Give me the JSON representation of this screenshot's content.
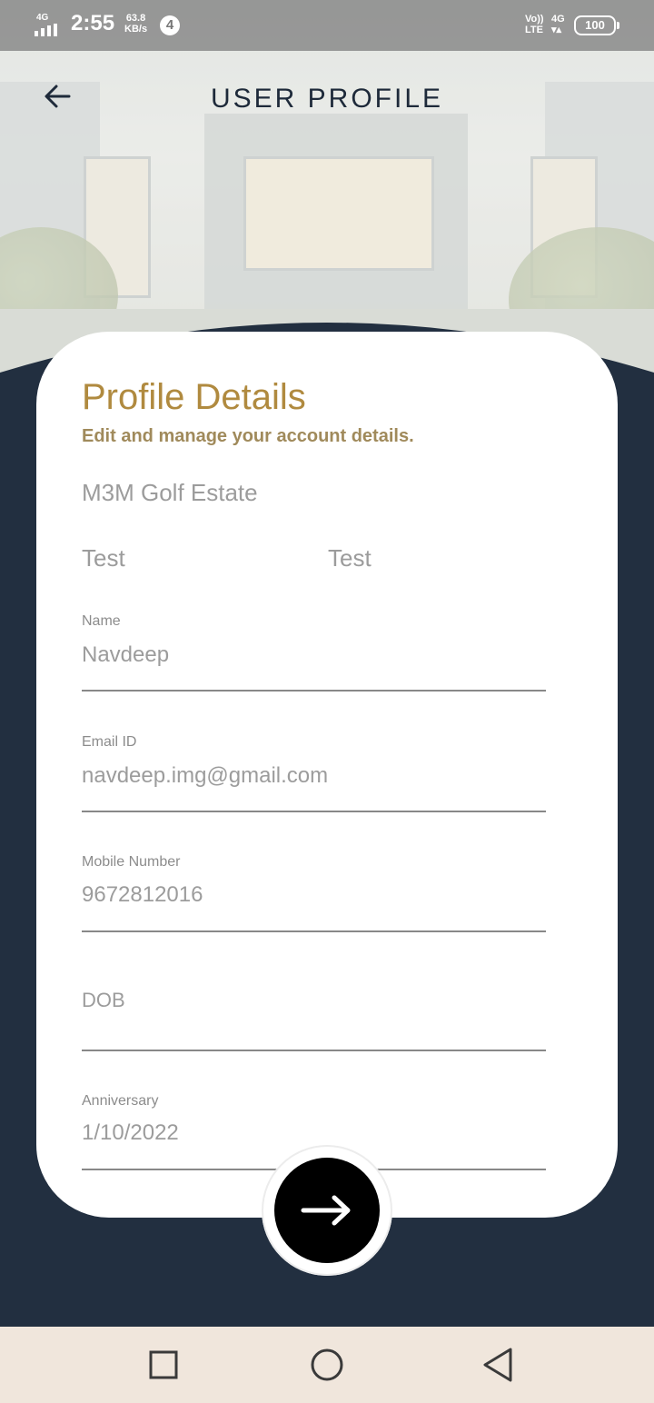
{
  "status_bar": {
    "network": "4G",
    "time": "2:55",
    "speed_value": "63.8",
    "speed_unit": "KB/s",
    "notification_count": "4",
    "volte_top": "Vo))",
    "volte_bottom": "LTE",
    "network_right": "4G",
    "battery": "100"
  },
  "header": {
    "title": "USER PROFILE"
  },
  "profile": {
    "heading": "Profile Details",
    "subheading": "Edit and manage your account details.",
    "estate": "M3M Golf Estate",
    "tower": "Test",
    "unit": "Test"
  },
  "fields": {
    "name": {
      "label": "Name",
      "value": "Navdeep"
    },
    "email": {
      "label": "Email ID",
      "value": "navdeep.img@gmail.com"
    },
    "mobile": {
      "label": "Mobile Number",
      "value": "9672812016"
    },
    "dob": {
      "placeholder": "DOB"
    },
    "anniversary": {
      "label": "Anniversary",
      "value": "1/10/2022"
    }
  },
  "colors": {
    "accent_gold": "#b08a3f",
    "navy": "#222f40",
    "fab": "#000000"
  },
  "icons": {
    "back": "arrow-left-icon",
    "submit": "arrow-right-icon",
    "nav_recents": "square-icon",
    "nav_home": "circle-icon",
    "nav_back": "triangle-back-icon"
  }
}
